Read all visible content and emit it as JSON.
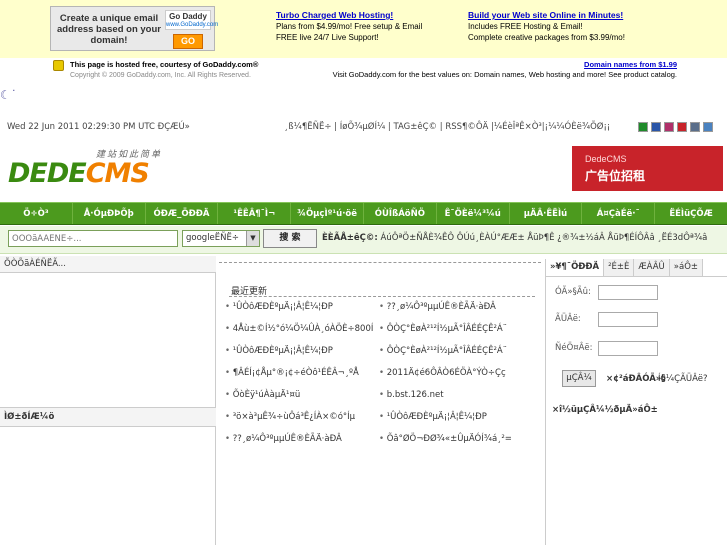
{
  "godaddy": {
    "ad_text": "Create a unique email address based on your domain!",
    "ad_logo": "Go Daddy",
    "ad_logo_url": "www.GoDaddy.com",
    "ad_go": "GO",
    "col1_title": "Turbo Charged Web Hosting!",
    "col1_line1": "Plans from $4.99/mo! Free setup & Email",
    "col1_line2": "FREE live 24/7 Live Support!",
    "col2_title": "Build your Web site Online in Minutes!",
    "col2_line1": "Includes FREE Hosting & Email!",
    "col2_line2": "Complete creative packages from $3.99/mo!",
    "hosted": "This page is hosted free, courtesy of GoDaddy.com®",
    "copyright": "Copyright © 2009 GoDaddy.com, Inc. All Rights Reserved.",
    "domain_link": "Domain names from $1.99",
    "visit_line": "Visit GoDaddy.com for the best values on: Domain names, Web hosting and more! See product catalog."
  },
  "topbar": {
    "date": "Wed 22 Jun 2011 02:29:30 PM UTC ÐÇÆÚ»",
    "links": "¸ß¼¶ËÑË÷ | ÍøÕ¾µØÍ¼ | TAG±êÇ© | RSS¶©ÔÄ  |¼ÉèÎªÊ×Ò³|¡¼¼ÓÈë¾ÕØ¡¡"
  },
  "swatch_colors": [
    "#1f8a2a",
    "#2a55a8",
    "#b0306a",
    "#c8232a",
    "#5a6e8a",
    "#4a82c0"
  ],
  "logo": {
    "word1": "DEDE",
    "word2": "CMS",
    "tagline": "建站如此简单"
  },
  "banner": {
    "line1": "DedeCMS",
    "line2": "广告位招租"
  },
  "nav": [
    "Ö÷Ò³",
    "Å·ÓµÐÞÕþ",
    "ÓÐÆ_ÖÐÐÄ",
    "¹ÊÊÂ¶¯Ì¬",
    "¾ÖµçÌº¹ú·öë",
    "ÓÙÎßÁöÑÖ",
    "Ê¯ÖÈë¼³¼ú",
    "µÄÂ·ÊËÌú",
    "Á¤ÇàÉë·¯",
    "ËÉÌüÇÕÆ"
  ],
  "search": {
    "placeholder": "ÕÒÕãÀÁÈÑË÷...",
    "engine": "googleËÑË÷",
    "button": "搜 索",
    "hot_label": "ÈÈÃÅ±êÇ©:",
    "hot_words": "ÁúÔªÖ±ÑÅÈ¾ÊÔ ÔÚú¸ÈÀÚ°ÆÆ± ÅüÞ¶Ê ¿®¾±½áÂ ÅüÞ¶ÉÍÔÂâ ¸ËÉ3dÔª¾â"
  },
  "left": {
    "tab": "ÕÒÕãÀÉÑËÃ...",
    "section": "ÌØ±ðÍÆ¼ö"
  },
  "center": {
    "heading": "最近更新",
    "col1": [
      "¹ÛÒôÆÐÈºµÄ¡¦Â¦Ê¼¦ÐP",
      "4Åù±©Í½°ó¼Ö¼ÛÀ¸óÀÖÈ÷800Í",
      "¹ÛÒôÆÐÈºµÄ¡¦Â¦Ê¼¦ÐP",
      "¶ÂÉÍ¡¢Åµ°®¡¢÷éÒô¹ÉÊÂ¬¸ºÅ",
      "ÕòÈÿ¹úÀàµÄ¹¤ü",
      "³ö×à³µÊ¾÷ùÔá³Ê¿ÍÀ×©ó°Íµ",
      "??¸ø¼Ô³ºµµÚÊ®ÈÃÄ·àÐÂ"
    ],
    "col2": [
      "??¸ø¼Ô³ºµµÚÊ®ÈÃÄ·àÐÂ",
      "ÔÒÇ°ÈøÀ²¹²Í½µÃ°ÎÂÉÉÇÊ²Á¨",
      "ÔÒÇ°ÈøÀ²¹²Í½µÃ°ÎÂÉÉÇÊ²Á¨",
      "2011Ä¢é6ÔÂÒ6ÉÖÀ°ÝÒ÷Çç",
      "b.bst.126.net",
      "¹ÛÒôÆÐÈºµÄ¡¦Â¦Ê¼¦ÐP",
      "Õâ°ØÖ¬ÐØ¾«±ÛµÄÓÍ¾á¸²="
    ]
  },
  "login": {
    "tabs": [
      "»¥¶¯ÖÐÐÄ",
      "²É±È",
      "ÆÀÂÛ",
      "»áÔ±"
    ],
    "user_label": "ÓÃ»§Ãû:",
    "pass_label": "ÃÜÂë:",
    "code_label": "ÑéÖ¤Âë:",
    "button": "µÇÂ¼",
    "register": "×¢²áÐÂÓÃ»§",
    "forgot": "Íü¼ÇÃÜÂë?",
    "links": "×î½üµÇÂ¼½ðµÄ»áÔ±"
  }
}
